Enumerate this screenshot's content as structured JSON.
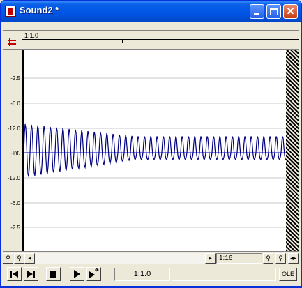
{
  "window": {
    "title": "Sound2 *"
  },
  "titlebar_buttons": [
    "minimize-icon",
    "maximize-icon",
    "close-icon"
  ],
  "close_glyph": "✕",
  "ruler": {
    "label": "1:1.0"
  },
  "y_axis": {
    "labels": [
      "-2.5",
      "-6.0",
      "-12.0",
      "-Inf.",
      "-12.0",
      "-6.0",
      "-2.5"
    ]
  },
  "waveform": {
    "type": "oscillating audio waveform",
    "color": "#000080",
    "centerline_color": "#0000cc"
  },
  "scrollbar": {
    "position": "1:16",
    "icons": [
      "zoom-out-icon",
      "zoom-in-icon",
      "scroll-left-icon",
      "scroll-right-icon",
      "zoom-out-icon",
      "zoom-in-icon",
      "zoom-fit-icon"
    ]
  },
  "transport": {
    "icons": [
      "rewind-icon",
      "fast-forward-icon",
      "stop-icon",
      "play-icon",
      "loop-play-icon"
    ],
    "time": "1:1.0",
    "ole_label": "OLE"
  }
}
